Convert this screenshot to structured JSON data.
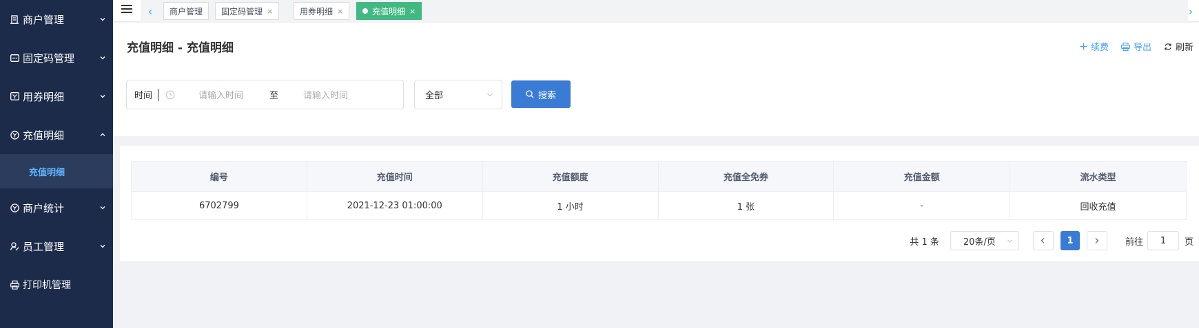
{
  "sidebar": {
    "items": [
      {
        "label": "商户管理",
        "icon": "building-icon"
      },
      {
        "label": "固定码管理",
        "icon": "code-icon"
      },
      {
        "label": "用券明细",
        "icon": "ticket-icon"
      },
      {
        "label": "充值明细",
        "icon": "recharge-icon"
      },
      {
        "label": "商户统计",
        "icon": "stats-icon"
      },
      {
        "label": "员工管理",
        "icon": "user-icon"
      },
      {
        "label": "打印机管理",
        "icon": "printer-icon"
      }
    ],
    "sub_item": {
      "label": "充值明细"
    }
  },
  "tabs": [
    {
      "label": "商户管理",
      "closable": false
    },
    {
      "label": "固定码管理",
      "closable": true
    },
    {
      "label": "用券明细",
      "closable": true
    },
    {
      "label": "充值明细",
      "closable": true,
      "active": true
    }
  ],
  "tab_close_glyph": "×",
  "header": {
    "title": "充值明细 - 充值明细",
    "actions": {
      "renew": "续费",
      "export": "导出",
      "refresh": "刷新"
    }
  },
  "filters": {
    "date_label": "时间",
    "start_placeholder": "请输入时间",
    "to_label": "至",
    "end_placeholder": "请输入时间",
    "select_value": "全部",
    "search_label": "搜索"
  },
  "table": {
    "headers": [
      "编号",
      "充值时间",
      "充值额度",
      "充值全免券",
      "充值金额",
      "流水类型"
    ],
    "rows": [
      [
        "6702799",
        "2021-12-23 01:00:00",
        "1 小时",
        "1 张",
        "-",
        "回收充值"
      ]
    ]
  },
  "pagination": {
    "total": "共 1 条",
    "page_size": "20条/页",
    "current_page": "1",
    "goto_label": "前往",
    "goto_value": "1",
    "page_unit": "页"
  },
  "colors": {
    "sidebar_bg": "#1c2b4a",
    "active_tab": "#42b983",
    "primary": "#3a7bd5",
    "link": "#409eff"
  }
}
